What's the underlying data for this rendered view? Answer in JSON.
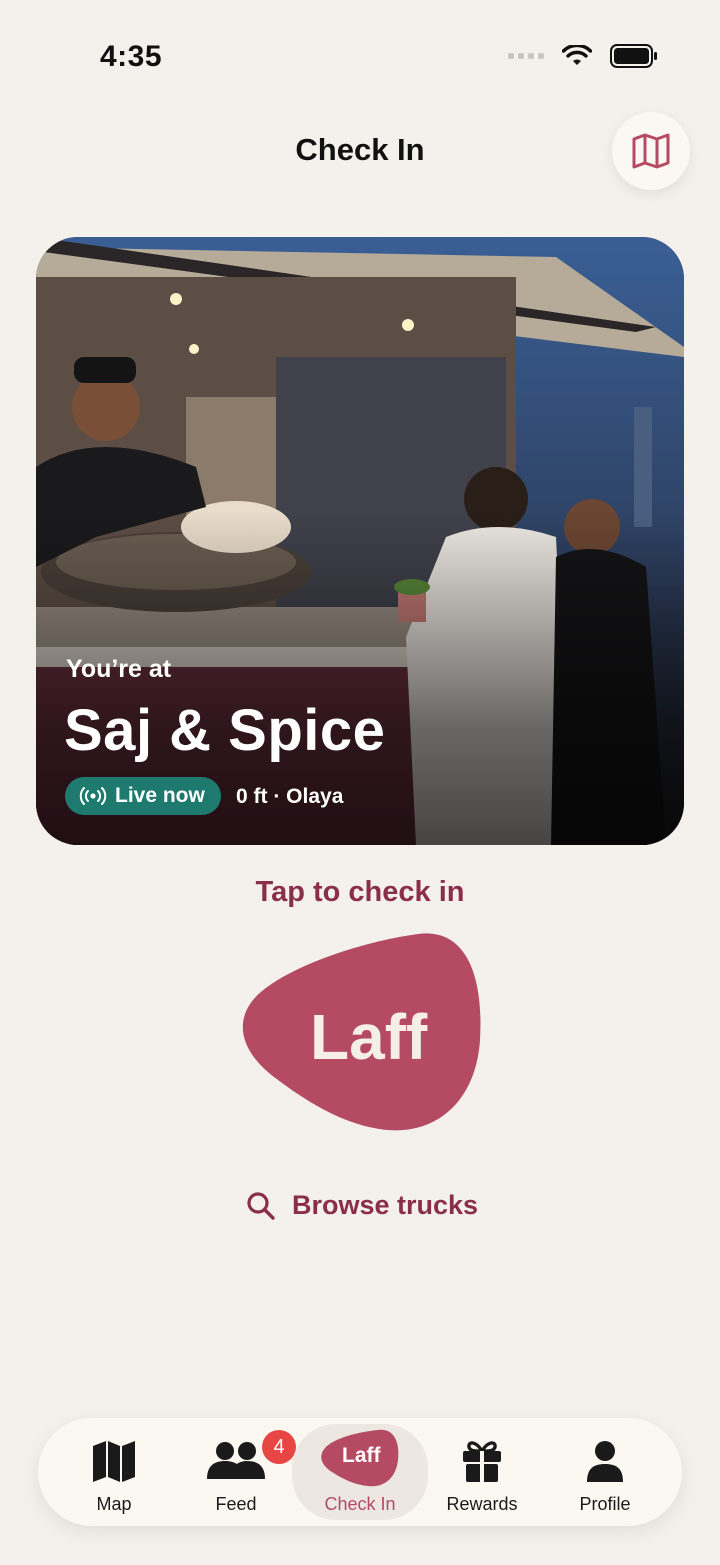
{
  "status": {
    "time": "4:35"
  },
  "header": {
    "title": "Check In",
    "map_icon": "map-icon"
  },
  "hero": {
    "subtitle": "You’re at",
    "truck_name": "Saj & Spice",
    "live_label": "Live now",
    "distance": "0 ft · Olaya"
  },
  "checkin": {
    "prompt": "Tap to check in",
    "button_label": "Laff",
    "browse_label": "Browse trucks"
  },
  "tabbar": {
    "items": [
      {
        "label": "Map",
        "icon": "map-icon"
      },
      {
        "label": "Feed",
        "icon": "people-icon",
        "badge": "4"
      },
      {
        "label": "Check In",
        "icon": "laff-logo-icon",
        "logo_text": "Laff"
      },
      {
        "label": "Rewards",
        "icon": "gift-icon"
      },
      {
        "label": "Profile",
        "icon": "person-icon"
      }
    ]
  },
  "colors": {
    "accent": "#b54a63",
    "accent_text": "#8a2e4c",
    "live": "#1e7a6e",
    "badge": "#e84545",
    "background": "#f4f1ec"
  }
}
